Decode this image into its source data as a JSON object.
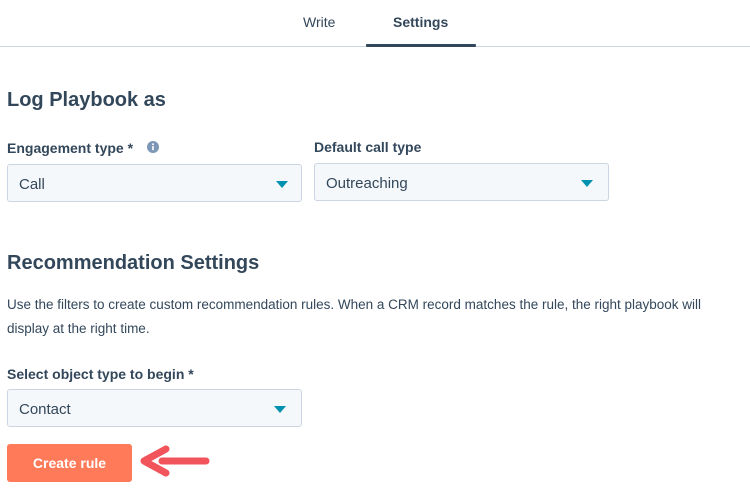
{
  "tabs": [
    {
      "label": "Write",
      "active": false
    },
    {
      "label": "Settings",
      "active": true
    }
  ],
  "log_section": {
    "title": "Log Playbook as",
    "engagement_type": {
      "label": "Engagement type *",
      "value": "Call",
      "icon": "info-icon"
    },
    "default_call_type": {
      "label": "Default call type",
      "value": "Outreaching"
    }
  },
  "recommendation_section": {
    "title": "Recommendation Settings",
    "description": "Use the filters to create custom recommendation rules. When a CRM record matches the rule, the right playbook will display at the right time.",
    "object_type": {
      "label": "Select object type to begin *",
      "value": "Contact"
    },
    "create_button": "Create rule"
  },
  "colors": {
    "text": "#33475b",
    "accent": "#ff7a59",
    "caret": "#0091ae",
    "input_bg": "#f5f8fa",
    "border": "#cbd6e2",
    "arrow": "#f2545b"
  }
}
